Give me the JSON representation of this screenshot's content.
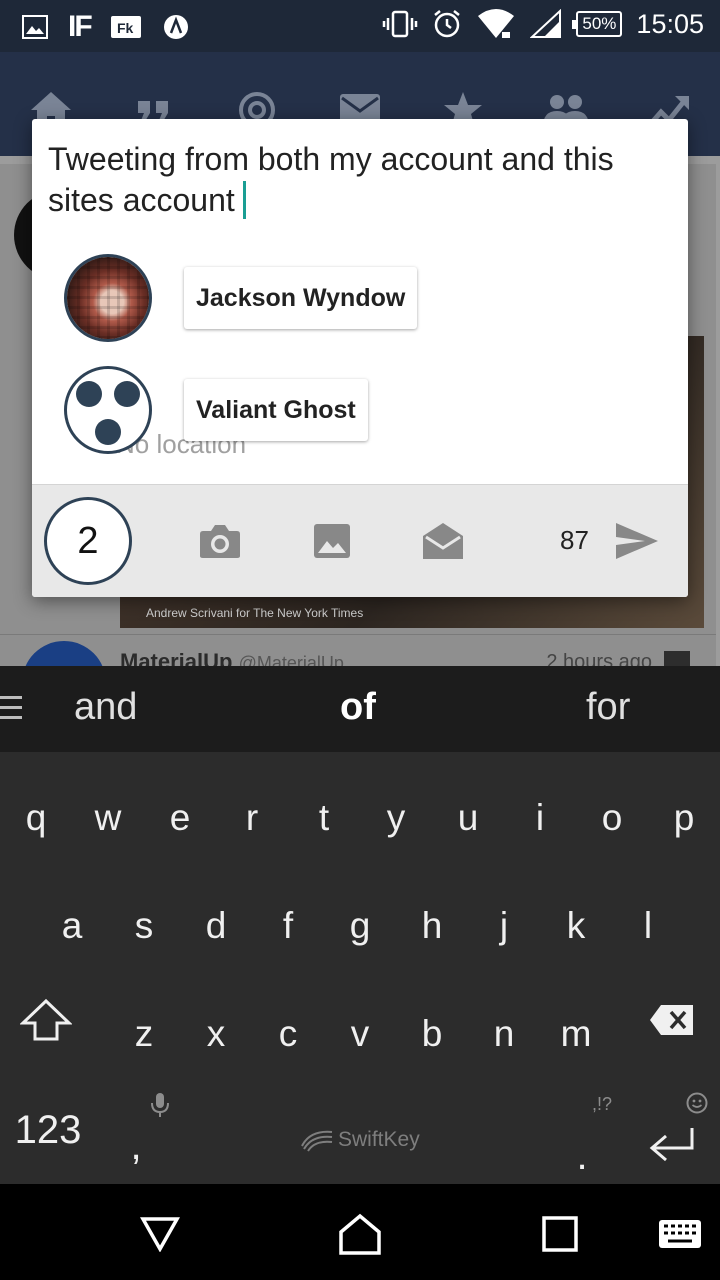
{
  "status_bar": {
    "battery": "50%",
    "time": "15:05",
    "left_icons": [
      "gallery-icon",
      "if-icon",
      "fk-icon",
      "signal-stream-icon"
    ],
    "right_icons": [
      "vibrate-icon",
      "alarm-icon",
      "wifi-icon",
      "cell-signal-icon"
    ]
  },
  "background_app": {
    "nav_icons": [
      "home-icon",
      "quote-icon",
      "mention-icon",
      "mail-icon",
      "star-icon",
      "people-icon",
      "trending-icon"
    ],
    "photo_credit": "Andrew Scrivani for The New York Times",
    "next_item_name": "MaterialUp",
    "next_item_handle": "@MaterialUp",
    "next_item_time": "2 hours ago"
  },
  "compose": {
    "text": "Tweeting from both my account and this sites account",
    "accounts": [
      {
        "name": "Jackson Wyndow",
        "avatar": "pixel-portrait"
      },
      {
        "name": "Valiant Ghost",
        "avatar": "three-dots-logo"
      }
    ],
    "location": "No location",
    "selected_count": "2",
    "remaining_chars": "87",
    "accent": "#1a9e94"
  },
  "keyboard": {
    "suggestions": [
      "and",
      "of",
      "for"
    ],
    "row1": [
      "q",
      "w",
      "e",
      "r",
      "t",
      "y",
      "u",
      "i",
      "o",
      "p"
    ],
    "row2": [
      "a",
      "s",
      "d",
      "f",
      "g",
      "h",
      "j",
      "k",
      "l"
    ],
    "row3": [
      "z",
      "x",
      "c",
      "v",
      "b",
      "n",
      "m"
    ],
    "numbers_key": "123",
    "comma_key": ",",
    "period_key": ".",
    "punct_hint": ",!?",
    "brand": "SwiftKey"
  }
}
